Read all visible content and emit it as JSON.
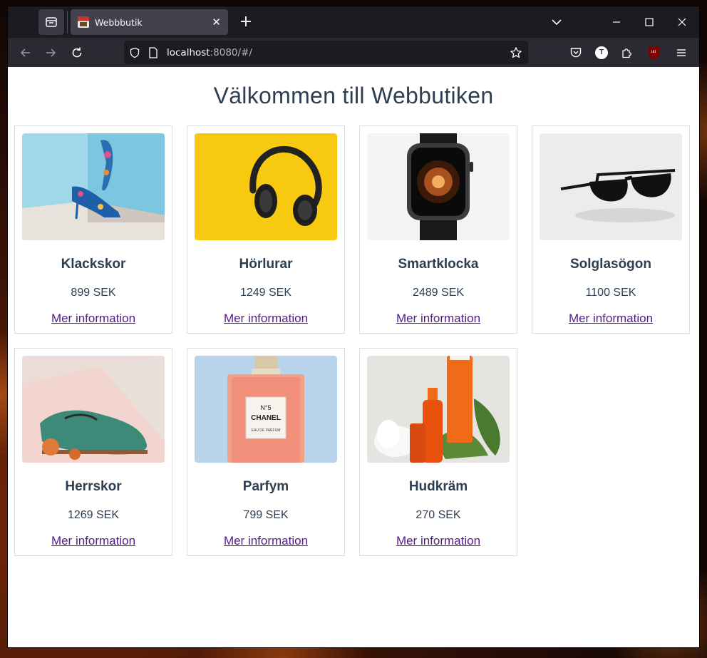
{
  "browser": {
    "tab_title": "Webbbutik",
    "url_host": "localhost",
    "url_rest": ":8080/#/",
    "profile_initial": "T",
    "extension_badge": "uo"
  },
  "page": {
    "heading": "Välkommen till Webbutiken",
    "link_label": "Mer information"
  },
  "products": [
    {
      "name": "Klackskor",
      "price": "899 SEK"
    },
    {
      "name": "Hörlurar",
      "price": "1249 SEK"
    },
    {
      "name": "Smartklocka",
      "price": "2489 SEK"
    },
    {
      "name": "Solglasögon",
      "price": "1100 SEK"
    },
    {
      "name": "Herrskor",
      "price": "1269 SEK"
    },
    {
      "name": "Parfym",
      "price": "799 SEK"
    },
    {
      "name": "Hudkräm",
      "price": "270 SEK"
    }
  ],
  "perfume_label": {
    "number": "N°5",
    "brand": "CHANEL",
    "sub": "EAU DE PARFUM"
  },
  "colors": {
    "heading": "#2c3e50",
    "link": "#551a8b",
    "chrome_dark": "#1c1b22",
    "chrome_nav": "#2b2a33"
  }
}
